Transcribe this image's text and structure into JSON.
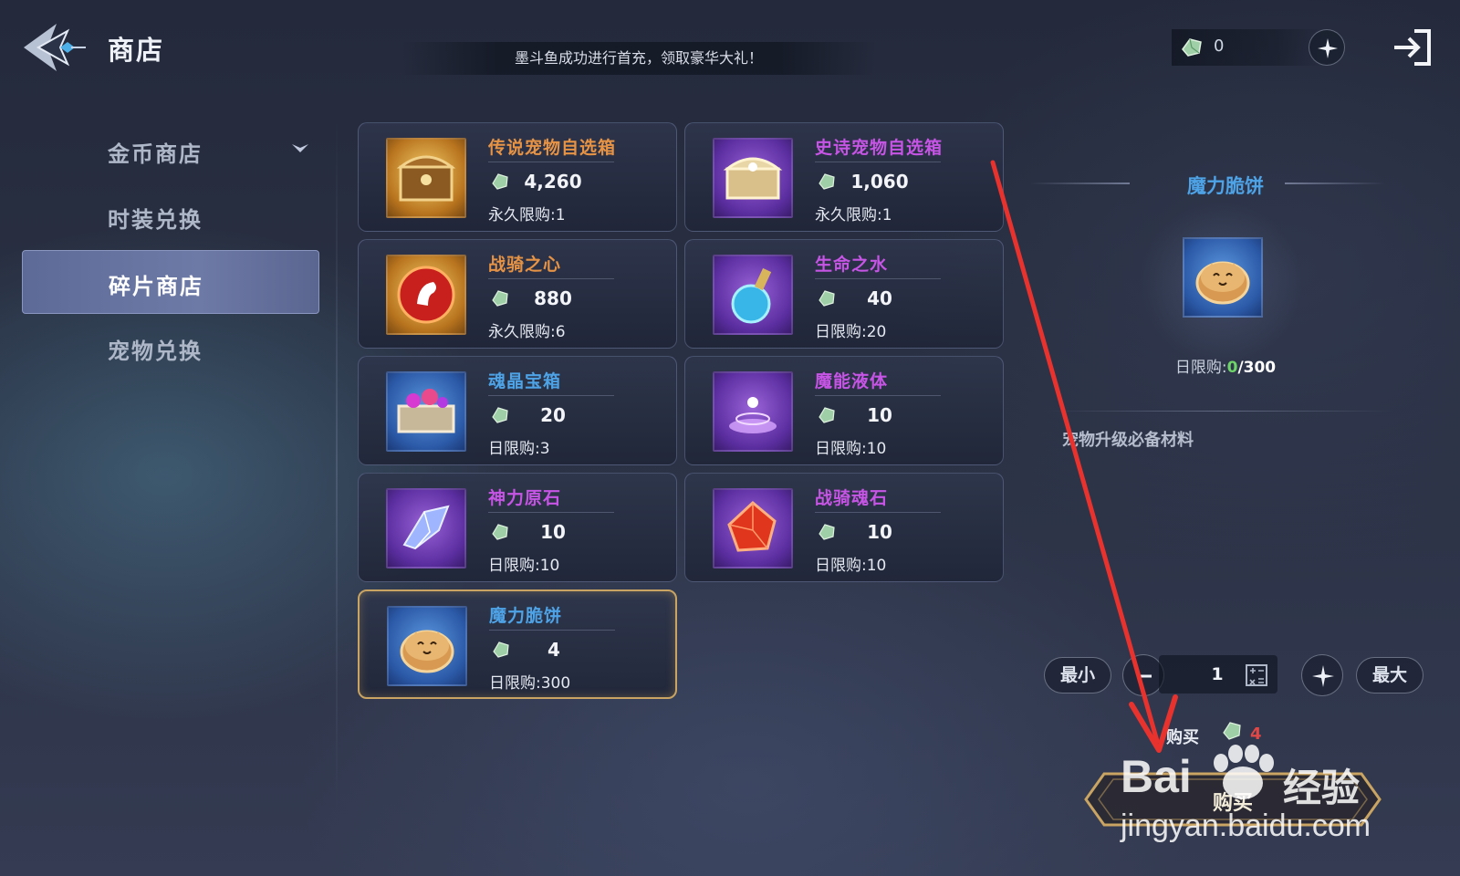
{
  "header": {
    "title": "商店",
    "notice": "墨斗鱼成功进行首充，领取豪华大礼！",
    "currency_amount": "0"
  },
  "sidebar": {
    "items": [
      {
        "label": "金币商店",
        "active": false,
        "has_dropdown": true
      },
      {
        "label": "时装兑换",
        "active": false
      },
      {
        "label": "碎片商店",
        "active": true
      },
      {
        "label": "宠物兑换",
        "active": false
      }
    ]
  },
  "shop_items": [
    {
      "name": "传说宠物自选箱",
      "price": "4,260",
      "limit": "永久限购:1",
      "rarity_color": "#e79345",
      "icon": "treasure-chest-icon",
      "frame": "gold"
    },
    {
      "name": "史诗宠物自选箱",
      "price": "1,060",
      "limit": "永久限购:1",
      "rarity_color": "#c654e4",
      "icon": "ornate-chest-icon",
      "frame": "purple"
    },
    {
      "name": "战骑之心",
      "price": "880",
      "limit": "永久限购:6",
      "rarity_color": "#e79345",
      "icon": "horse-orb-icon",
      "frame": "gold"
    },
    {
      "name": "生命之水",
      "price": "40",
      "limit": "日限购:20",
      "rarity_color": "#c654e4",
      "icon": "potion-bottle-icon",
      "frame": "purple"
    },
    {
      "name": "魂晶宝箱",
      "price": "20",
      "limit": "日限购:3",
      "rarity_color": "#4ea2e6",
      "icon": "gem-chest-icon",
      "frame": "blue"
    },
    {
      "name": "魔能液体",
      "price": "10",
      "limit": "日限购:10",
      "rarity_color": "#c654e4",
      "icon": "magic-liquid-icon",
      "frame": "purple"
    },
    {
      "name": "神力原石",
      "price": "10",
      "limit": "日限购:10",
      "rarity_color": "#c654e4",
      "icon": "crystal-shard-icon",
      "frame": "purple"
    },
    {
      "name": "战骑魂石",
      "price": "10",
      "limit": "日限购:10",
      "rarity_color": "#c654e4",
      "icon": "red-soul-stone-icon",
      "frame": "purple"
    },
    {
      "name": "魔力脆饼",
      "price": "4",
      "limit": "日限购:300",
      "rarity_color": "#4ea2e6",
      "icon": "cookie-icon",
      "frame": "blue",
      "selected": true
    }
  ],
  "detail": {
    "name": "魔力脆饼",
    "limit_label": "日限购:",
    "limit_current": "0",
    "limit_max": "/300",
    "description": "宠物升级必备材料"
  },
  "quantity": {
    "min_label": "最小",
    "max_label": "最大",
    "value": "1"
  },
  "purchase": {
    "total_label": "购买",
    "total_value": "4",
    "button_label": "购买"
  },
  "watermark": {
    "brand": "Bai",
    "brand_suffix": "经验",
    "url": "jingyan.baidu.com"
  },
  "colors": {
    "legendary": "#e79345",
    "epic": "#c654e4",
    "rare": "#4ea2e6",
    "selected_border": "#c9a462",
    "annotation_arrow": "#e8322e"
  }
}
